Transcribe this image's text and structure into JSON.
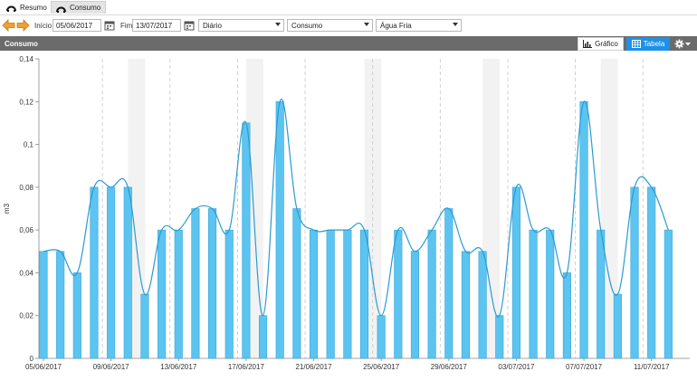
{
  "tabs": [
    {
      "label": "Resumo",
      "active": false
    },
    {
      "label": "Consumo",
      "active": true
    }
  ],
  "toolbar": {
    "start_label": "Início",
    "start_value": "05/06/2017",
    "end_label": "Fim",
    "end_value": "13/07/2017",
    "period_select": "Diário",
    "metric_select": "Consumo",
    "resource_select": "Água Fria"
  },
  "panel": {
    "title": "Consumo",
    "grafico_label": "Gráfico",
    "tabela_label": "Tabela"
  },
  "colors": {
    "bar": "#5bc4f1",
    "line": "#2b9bd0",
    "accent": "#1e90e8",
    "header": "#6b6b6b",
    "weekend_band": "#f2f2f2"
  },
  "chart_data": {
    "type": "bar",
    "ylabel": "m3",
    "xlabel": "",
    "ylim": [
      0,
      0.14
    ],
    "yticks": [
      "0",
      "0,02",
      "0,04",
      "0,06",
      "0,08",
      "0,1",
      "0,12",
      "0,14"
    ],
    "x_tick_labels": [
      "05/06/2017",
      "09/06/2017",
      "13/06/2017",
      "17/06/2017",
      "21/06/2017",
      "25/06/2017",
      "29/06/2017",
      "03/07/2017",
      "07/07/2017",
      "11/07/2017"
    ],
    "categories": [
      "05/06",
      "06/06",
      "07/06",
      "08/06",
      "09/06",
      "10/06",
      "11/06",
      "12/06",
      "13/06",
      "14/06",
      "15/06",
      "16/06",
      "17/06",
      "18/06",
      "19/06",
      "20/06",
      "21/06",
      "22/06",
      "23/06",
      "24/06",
      "25/06",
      "26/06",
      "27/06",
      "28/06",
      "29/06",
      "30/06",
      "01/07",
      "02/07",
      "03/07",
      "04/07",
      "05/07",
      "06/07",
      "07/07",
      "08/07",
      "09/07",
      "10/07",
      "11/07",
      "12/07",
      "13/07"
    ],
    "values": [
      0.05,
      0.05,
      0.04,
      0.08,
      0.08,
      0.08,
      0.03,
      0.06,
      0.06,
      0.07,
      0.07,
      0.06,
      0.11,
      0.02,
      0.12,
      0.07,
      0.06,
      0.06,
      0.06,
      0.06,
      0.02,
      0.06,
      0.05,
      0.06,
      0.07,
      0.05,
      0.05,
      0.02,
      0.08,
      0.06,
      0.06,
      0.04,
      0.12,
      0.06,
      0.03,
      0.08,
      0.08,
      0.06
    ],
    "weekend_bands": [
      [
        "10/06",
        "11/06"
      ],
      [
        "17/06",
        "18/06"
      ],
      [
        "24/06",
        "25/06"
      ],
      [
        "01/07",
        "02/07"
      ],
      [
        "08/07",
        "09/07"
      ]
    ],
    "smoothed_line": true,
    "grid": false
  }
}
